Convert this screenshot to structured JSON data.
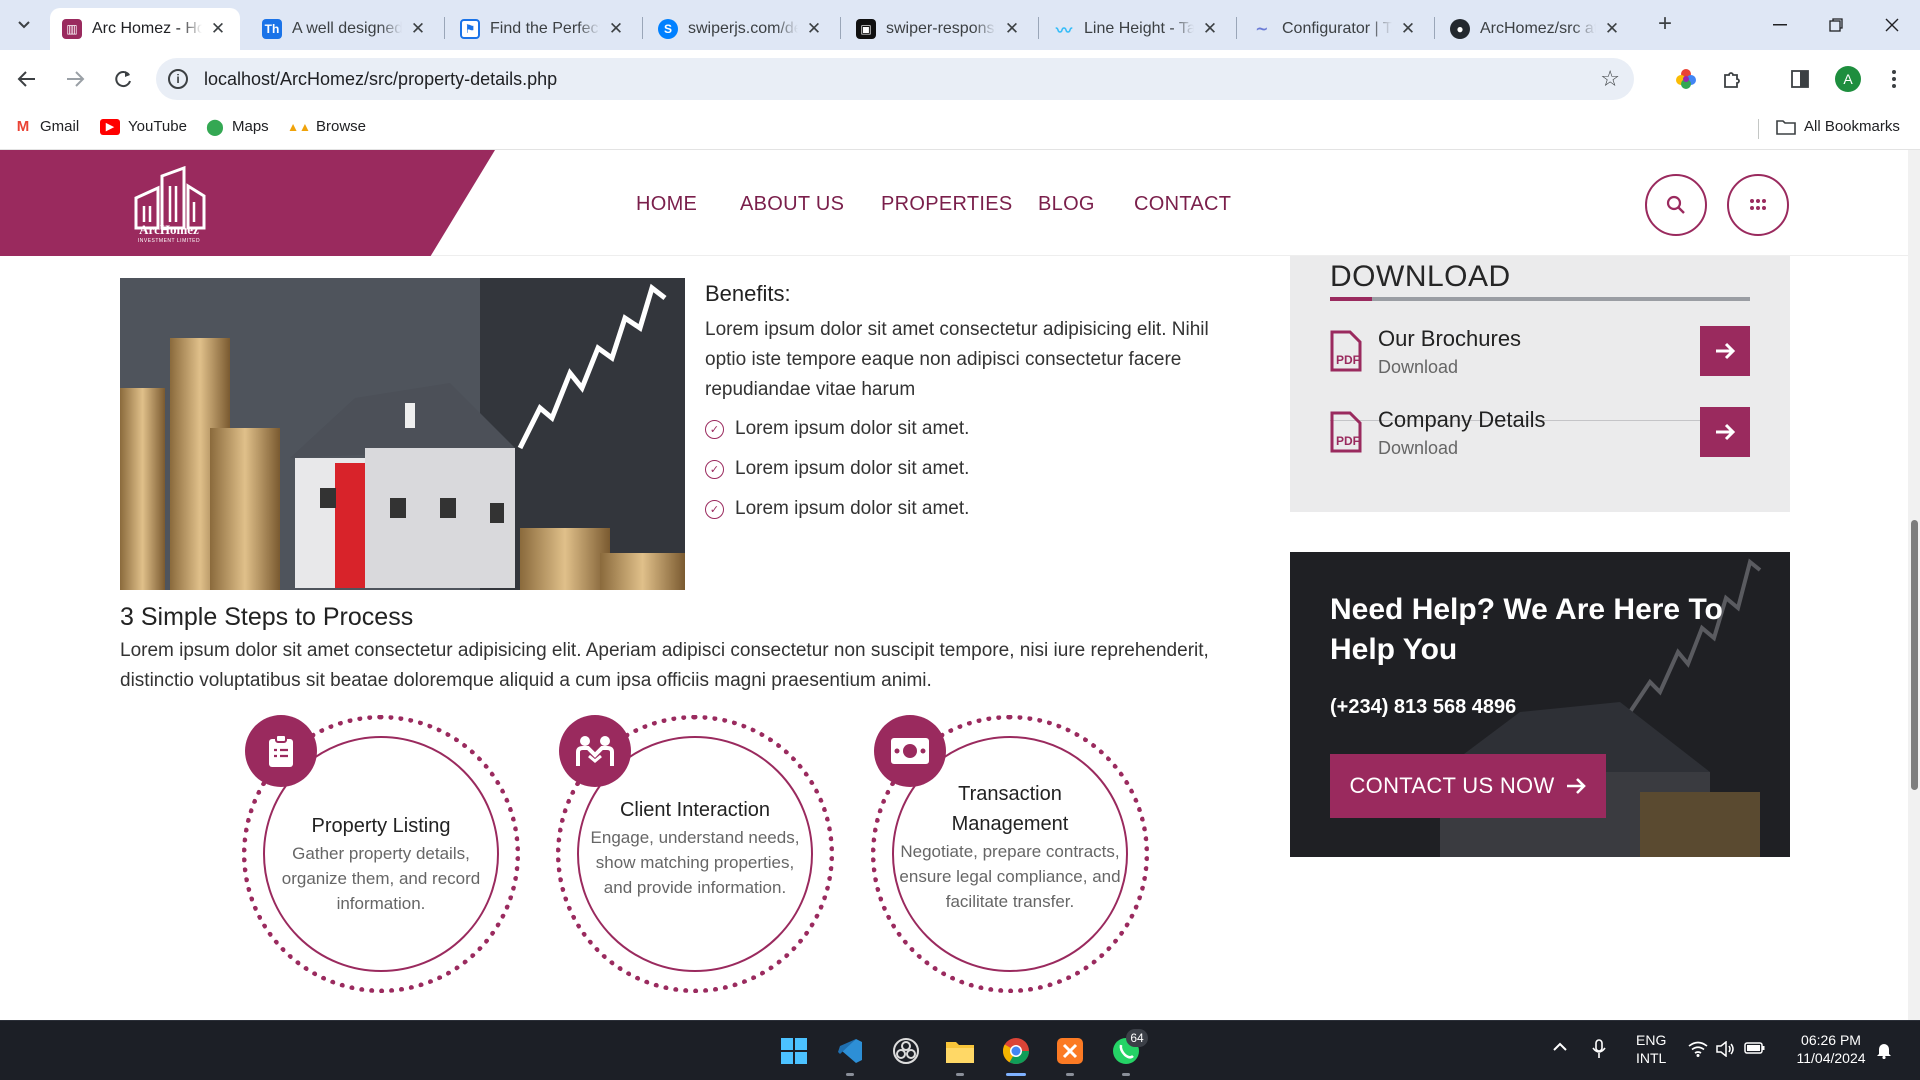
{
  "browser": {
    "tabs": [
      {
        "title": "Arc Homez - Ho",
        "active": true,
        "icon": "archomez-favicon"
      },
      {
        "title": "A well designed",
        "active": false,
        "icon": "th-favicon"
      },
      {
        "title": "Find the Perfect",
        "active": false,
        "icon": "flag-favicon"
      },
      {
        "title": "swiperjs.com/de",
        "active": false,
        "icon": "swiper-favicon"
      },
      {
        "title": "swiper-responsiv",
        "active": false,
        "icon": "codesandbox-favicon"
      },
      {
        "title": "Line Height - Tai",
        "active": false,
        "icon": "tailwind-favicon"
      },
      {
        "title": "Configurator | Ta",
        "active": false,
        "icon": "configurator-favicon"
      },
      {
        "title": "ArcHomez/src at",
        "active": false,
        "icon": "github-favicon"
      }
    ],
    "address": "localhost/ArcHomez/src/property-details.php",
    "profile_initial": "A",
    "bookmarks": [
      {
        "label": "Gmail",
        "icon": "gmail-icon"
      },
      {
        "label": "YouTube",
        "icon": "youtube-icon"
      },
      {
        "label": "Maps",
        "icon": "maps-icon"
      },
      {
        "label": "Browse",
        "icon": "phpmyadmin-icon"
      }
    ],
    "all_bookmarks": "All Bookmarks"
  },
  "site": {
    "logo_text": "ArcHomez",
    "logo_sub": "INVESTMENT LIMITED",
    "nav": [
      "HOME",
      "ABOUT US",
      "PROPERTIES",
      "BLOG",
      "CONTACT"
    ],
    "brand_color": "#9a2a5e"
  },
  "content": {
    "benefits_title": "Benefits:",
    "benefits_text": "Lorem ipsum dolor sit amet consectetur adipisicing elit. Nihil optio iste tempore eaque non adipisci consectetur facere repudiandae vitae harum",
    "checklist": [
      "Lorem ipsum dolor sit amet.",
      "Lorem ipsum dolor sit amet.",
      "Lorem ipsum dolor sit amet."
    ],
    "steps_title": "3 Simple Steps to Process",
    "steps_text": "Lorem ipsum dolor sit amet consectetur adipisicing elit. Aperiam adipisci consectetur non suscipit tempore, nisi iure reprehenderit, distinctio voluptatibus sit beatae doloremque aliquid a cum ipsa officiis magni praesentium animi.",
    "steps": [
      {
        "title": "Property Listing",
        "desc": "Gather property details, organize them, and record information.",
        "icon": "clipboard-icon"
      },
      {
        "title": "Client Interaction",
        "desc": "Engage, understand needs, show matching properties, and provide information.",
        "icon": "handshake-icon"
      },
      {
        "title": "Transaction Management",
        "desc": "Negotiate, prepare contracts, ensure legal compliance, and facilitate transfer.",
        "icon": "money-icon"
      }
    ]
  },
  "sidebar": {
    "download_heading": "DOWNLOAD",
    "downloads": [
      {
        "name": "Our Brochures",
        "sub": "Download"
      },
      {
        "name": "Company Details",
        "sub": "Download"
      }
    ],
    "help_title": "Need Help? We Are Here To Help You",
    "help_phone": "(+234) 813 568 4896",
    "help_button": "CONTACT US NOW"
  },
  "taskbar": {
    "lang_top": "ENG",
    "lang_bottom": "INTL",
    "time": "06:26 PM",
    "date": "11/04/2024",
    "whatsapp_badge": "64"
  }
}
